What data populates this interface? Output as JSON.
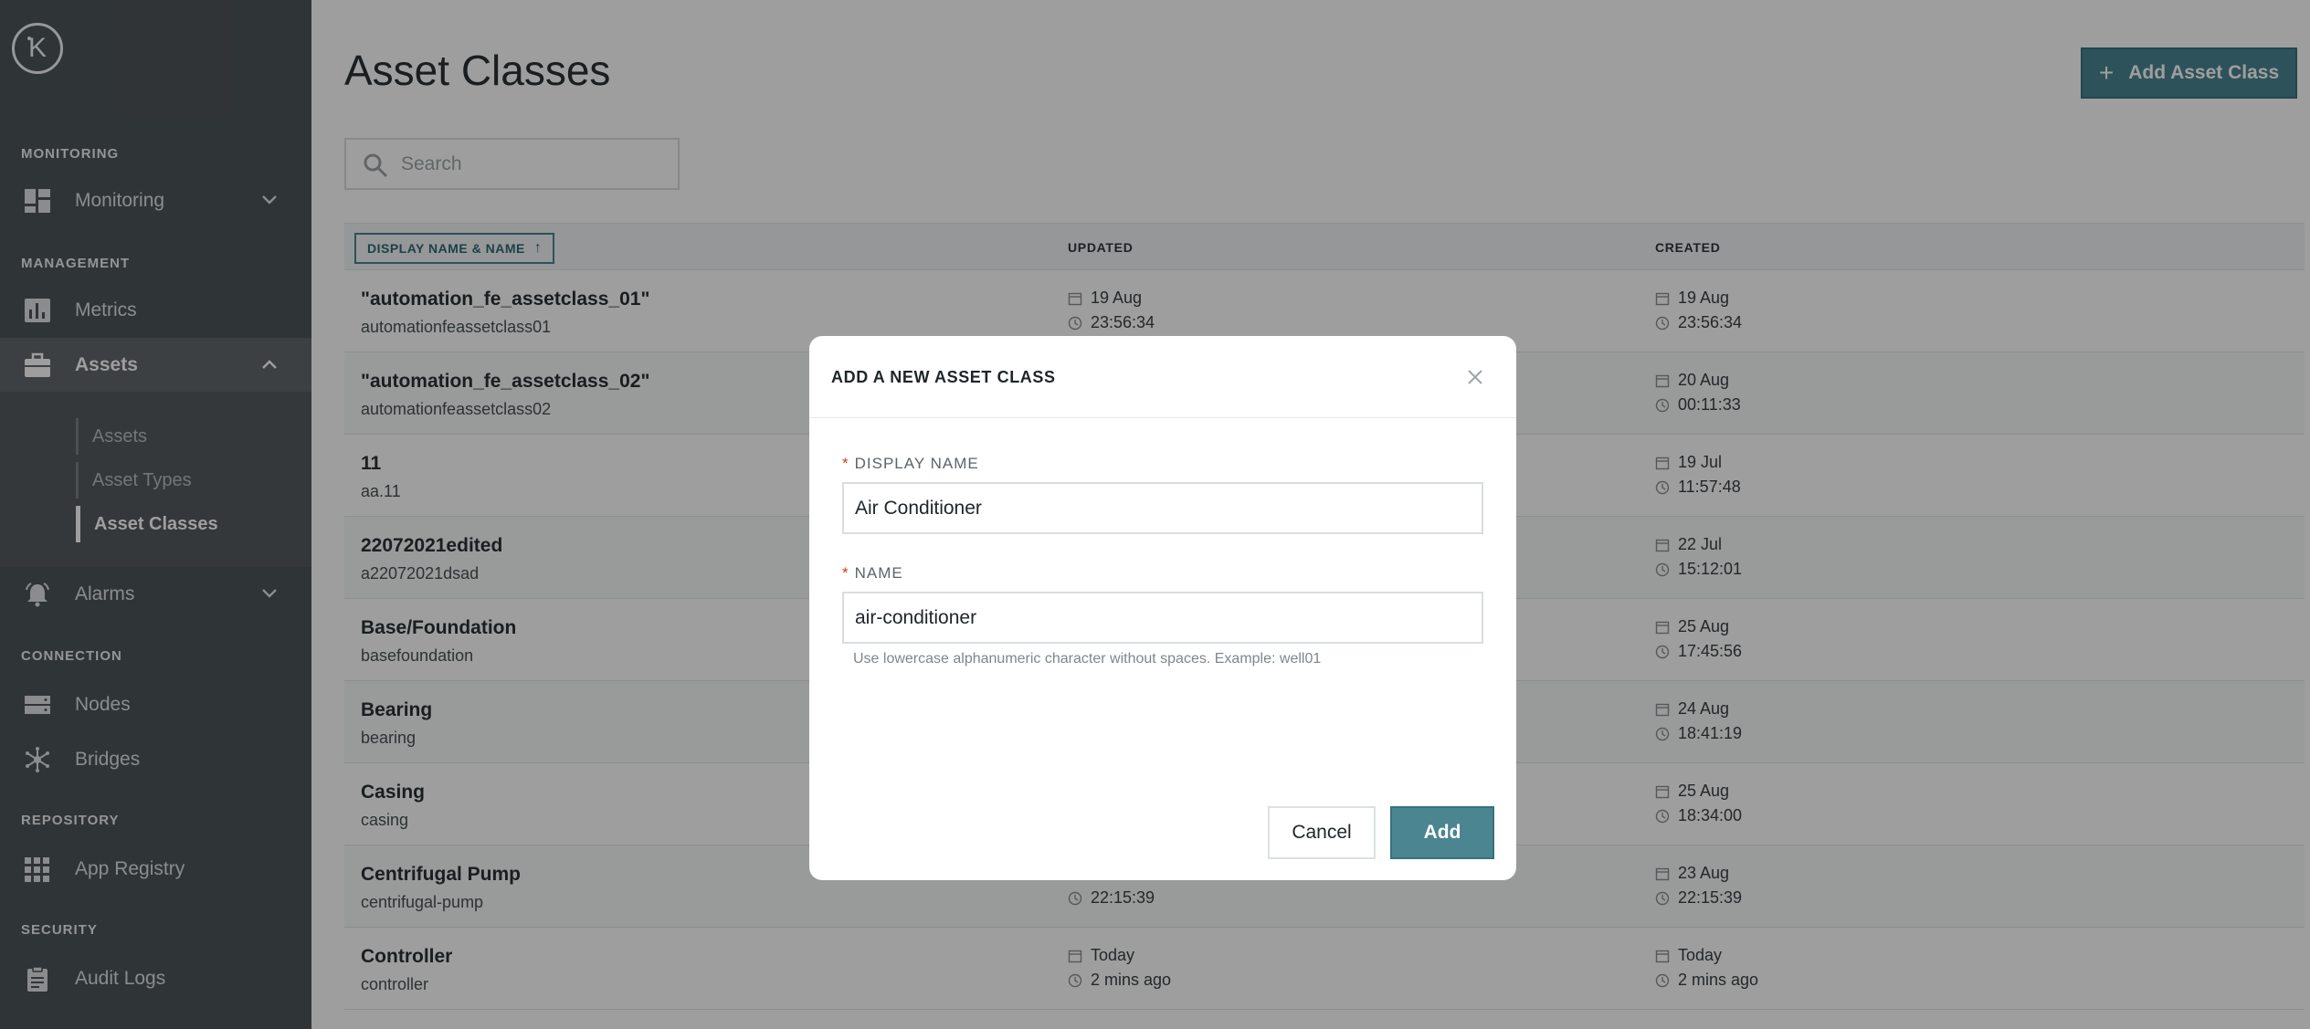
{
  "sidebar": {
    "logo_letter": "K",
    "sections": {
      "monitoring": "MONITORING",
      "management": "MANAGEMENT",
      "connection": "CONNECTION",
      "repository": "REPOSITORY",
      "security": "SECURITY"
    },
    "items": {
      "monitoring": "Monitoring",
      "metrics": "Metrics",
      "assets": "Assets",
      "alarms": "Alarms",
      "nodes": "Nodes",
      "bridges": "Bridges",
      "app_registry": "App Registry",
      "audit_logs": "Audit Logs"
    },
    "sub_items": {
      "assets": "Assets",
      "asset_types": "Asset Types",
      "asset_classes": "Asset Classes"
    }
  },
  "page": {
    "title": "Asset Classes",
    "add_button": "Add Asset Class",
    "search_placeholder": "Search"
  },
  "table": {
    "headers": {
      "name": "DISPLAY NAME & NAME",
      "updated": "UPDATED",
      "created": "CREATED"
    },
    "rows": [
      {
        "display_name": "\"automation_fe_assetclass_01\"",
        "name": "automationfeassetclass01",
        "updated_date": "19 Aug",
        "updated_time": "23:56:34",
        "created_date": "19 Aug",
        "created_time": "23:56:34"
      },
      {
        "display_name": "\"automation_fe_assetclass_02\"",
        "name": "automationfeassetclass02",
        "updated_date": "",
        "updated_time": "",
        "created_date": "20 Aug",
        "created_time": "00:11:33"
      },
      {
        "display_name": "11",
        "name": "aa.11",
        "updated_date": "",
        "updated_time": "",
        "created_date": "19 Jul",
        "created_time": "11:57:48"
      },
      {
        "display_name": "22072021edited",
        "name": "a22072021dsad",
        "updated_date": "",
        "updated_time": "",
        "created_date": "22 Jul",
        "created_time": "15:12:01"
      },
      {
        "display_name": "Base/Foundation",
        "name": "basefoundation",
        "updated_date": "",
        "updated_time": "",
        "created_date": "25 Aug",
        "created_time": "17:45:56"
      },
      {
        "display_name": "Bearing",
        "name": "bearing",
        "updated_date": "",
        "updated_time": "",
        "created_date": "24 Aug",
        "created_time": "18:41:19"
      },
      {
        "display_name": "Casing",
        "name": "casing",
        "updated_date": "",
        "updated_time": "",
        "created_date": "25 Aug",
        "created_time": "18:34:00"
      },
      {
        "display_name": "Centrifugal Pump",
        "name": "centrifugal-pump",
        "updated_date": "",
        "updated_time": "22:15:39",
        "created_date": "23 Aug",
        "created_time": "22:15:39"
      },
      {
        "display_name": "Controller",
        "name": "controller",
        "updated_date": "Today",
        "updated_time": "2 mins ago",
        "created_date": "Today",
        "created_time": "2 mins ago"
      }
    ]
  },
  "modal": {
    "title": "ADD A NEW ASSET CLASS",
    "display_name_label": "DISPLAY NAME",
    "display_name_value": "Air Conditioner",
    "name_label": "NAME",
    "name_value": "air-conditioner",
    "required_mark": "*",
    "hint": "Use lowercase alphanumeric character without spaces. Example: well01",
    "cancel_label": "Cancel",
    "add_label": "Add"
  },
  "colors": {
    "sidebar_bg": "#4d5457",
    "accent": "#4b8592",
    "required": "#d43b1a"
  }
}
